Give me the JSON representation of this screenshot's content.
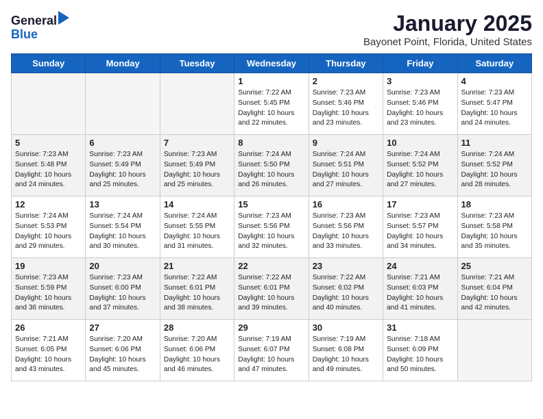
{
  "header": {
    "logo_line1": "General",
    "logo_line2": "Blue",
    "month_title": "January 2025",
    "location": "Bayonet Point, Florida, United States"
  },
  "days_of_week": [
    "Sunday",
    "Monday",
    "Tuesday",
    "Wednesday",
    "Thursday",
    "Friday",
    "Saturday"
  ],
  "weeks": [
    [
      {
        "day": "",
        "empty": true
      },
      {
        "day": "",
        "empty": true
      },
      {
        "day": "",
        "empty": true
      },
      {
        "day": "1",
        "sunrise": "7:22 AM",
        "sunset": "5:45 PM",
        "daylight": "10 hours and 22 minutes."
      },
      {
        "day": "2",
        "sunrise": "7:23 AM",
        "sunset": "5:46 PM",
        "daylight": "10 hours and 23 minutes."
      },
      {
        "day": "3",
        "sunrise": "7:23 AM",
        "sunset": "5:46 PM",
        "daylight": "10 hours and 23 minutes."
      },
      {
        "day": "4",
        "sunrise": "7:23 AM",
        "sunset": "5:47 PM",
        "daylight": "10 hours and 24 minutes."
      }
    ],
    [
      {
        "day": "5",
        "sunrise": "7:23 AM",
        "sunset": "5:48 PM",
        "daylight": "10 hours and 24 minutes."
      },
      {
        "day": "6",
        "sunrise": "7:23 AM",
        "sunset": "5:49 PM",
        "daylight": "10 hours and 25 minutes."
      },
      {
        "day": "7",
        "sunrise": "7:23 AM",
        "sunset": "5:49 PM",
        "daylight": "10 hours and 25 minutes."
      },
      {
        "day": "8",
        "sunrise": "7:24 AM",
        "sunset": "5:50 PM",
        "daylight": "10 hours and 26 minutes."
      },
      {
        "day": "9",
        "sunrise": "7:24 AM",
        "sunset": "5:51 PM",
        "daylight": "10 hours and 27 minutes."
      },
      {
        "day": "10",
        "sunrise": "7:24 AM",
        "sunset": "5:52 PM",
        "daylight": "10 hours and 27 minutes."
      },
      {
        "day": "11",
        "sunrise": "7:24 AM",
        "sunset": "5:52 PM",
        "daylight": "10 hours and 28 minutes."
      }
    ],
    [
      {
        "day": "12",
        "sunrise": "7:24 AM",
        "sunset": "5:53 PM",
        "daylight": "10 hours and 29 minutes."
      },
      {
        "day": "13",
        "sunrise": "7:24 AM",
        "sunset": "5:54 PM",
        "daylight": "10 hours and 30 minutes."
      },
      {
        "day": "14",
        "sunrise": "7:24 AM",
        "sunset": "5:55 PM",
        "daylight": "10 hours and 31 minutes."
      },
      {
        "day": "15",
        "sunrise": "7:23 AM",
        "sunset": "5:56 PM",
        "daylight": "10 hours and 32 minutes."
      },
      {
        "day": "16",
        "sunrise": "7:23 AM",
        "sunset": "5:56 PM",
        "daylight": "10 hours and 33 minutes."
      },
      {
        "day": "17",
        "sunrise": "7:23 AM",
        "sunset": "5:57 PM",
        "daylight": "10 hours and 34 minutes."
      },
      {
        "day": "18",
        "sunrise": "7:23 AM",
        "sunset": "5:58 PM",
        "daylight": "10 hours and 35 minutes."
      }
    ],
    [
      {
        "day": "19",
        "sunrise": "7:23 AM",
        "sunset": "5:59 PM",
        "daylight": "10 hours and 36 minutes."
      },
      {
        "day": "20",
        "sunrise": "7:23 AM",
        "sunset": "6:00 PM",
        "daylight": "10 hours and 37 minutes."
      },
      {
        "day": "21",
        "sunrise": "7:22 AM",
        "sunset": "6:01 PM",
        "daylight": "10 hours and 38 minutes."
      },
      {
        "day": "22",
        "sunrise": "7:22 AM",
        "sunset": "6:01 PM",
        "daylight": "10 hours and 39 minutes."
      },
      {
        "day": "23",
        "sunrise": "7:22 AM",
        "sunset": "6:02 PM",
        "daylight": "10 hours and 40 minutes."
      },
      {
        "day": "24",
        "sunrise": "7:21 AM",
        "sunset": "6:03 PM",
        "daylight": "10 hours and 41 minutes."
      },
      {
        "day": "25",
        "sunrise": "7:21 AM",
        "sunset": "6:04 PM",
        "daylight": "10 hours and 42 minutes."
      }
    ],
    [
      {
        "day": "26",
        "sunrise": "7:21 AM",
        "sunset": "6:05 PM",
        "daylight": "10 hours and 43 minutes."
      },
      {
        "day": "27",
        "sunrise": "7:20 AM",
        "sunset": "6:06 PM",
        "daylight": "10 hours and 45 minutes."
      },
      {
        "day": "28",
        "sunrise": "7:20 AM",
        "sunset": "6:06 PM",
        "daylight": "10 hours and 46 minutes."
      },
      {
        "day": "29",
        "sunrise": "7:19 AM",
        "sunset": "6:07 PM",
        "daylight": "10 hours and 47 minutes."
      },
      {
        "day": "30",
        "sunrise": "7:19 AM",
        "sunset": "6:08 PM",
        "daylight": "10 hours and 49 minutes."
      },
      {
        "day": "31",
        "sunrise": "7:18 AM",
        "sunset": "6:09 PM",
        "daylight": "10 hours and 50 minutes."
      },
      {
        "day": "",
        "empty": true
      }
    ]
  ],
  "labels": {
    "sunrise_prefix": "Sunrise: ",
    "sunset_prefix": "Sunset: ",
    "daylight_prefix": "Daylight: "
  }
}
